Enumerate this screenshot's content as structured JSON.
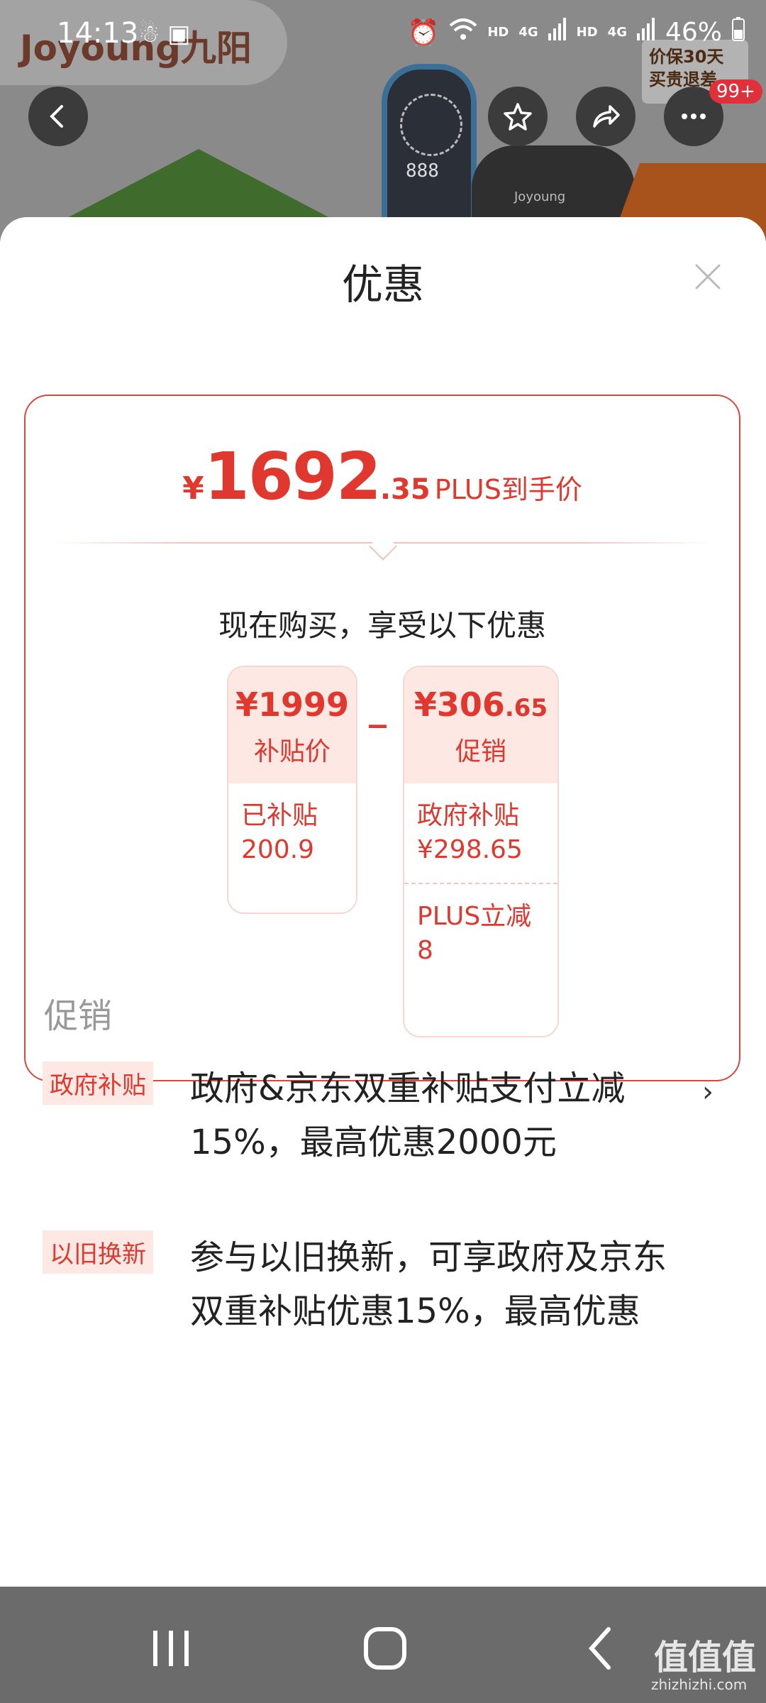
{
  "background": {
    "brand": "Joyoung九阳",
    "badge_tag": "价保30天 买贵退差"
  },
  "status_bar": {
    "time": "14:13",
    "battery": "46%",
    "network_1": "HD",
    "network_2": "4G",
    "network_3": "HD",
    "network_4": "4G"
  },
  "header": {
    "cart_badge": "99+"
  },
  "sheet": {
    "title": "优惠",
    "final_price": {
      "currency": "¥",
      "integer": "1692",
      "decimal": ".35",
      "suffix": "PLUS到手价"
    },
    "buy_now_text": "现在购买，享受以下优惠",
    "subsidy_price": {
      "amount": "¥1999",
      "label": "补贴价",
      "detail": "已补贴200.9"
    },
    "minus": "_",
    "promotion": {
      "amount": "¥306",
      "decimal": ".65",
      "label": "促销",
      "items": [
        "政府补贴 ¥298.65",
        "PLUS立减8"
      ]
    }
  },
  "promotions_section": {
    "title": "促销",
    "items": [
      {
        "tag": "政府补贴",
        "text": "政府&京东双重补贴支付立减15%，最高优惠2000元"
      },
      {
        "tag": "以旧换新",
        "text": "参与以旧换新，可享政府及京东双重补贴优惠15%，最高优惠"
      }
    ]
  },
  "watermark": {
    "logo": "值值值",
    "site": "zhizhizhi.com"
  },
  "colors": {
    "accent": "#e0382e",
    "tag_bg": "#fde8e4",
    "navbar": "#6b6b6b"
  }
}
